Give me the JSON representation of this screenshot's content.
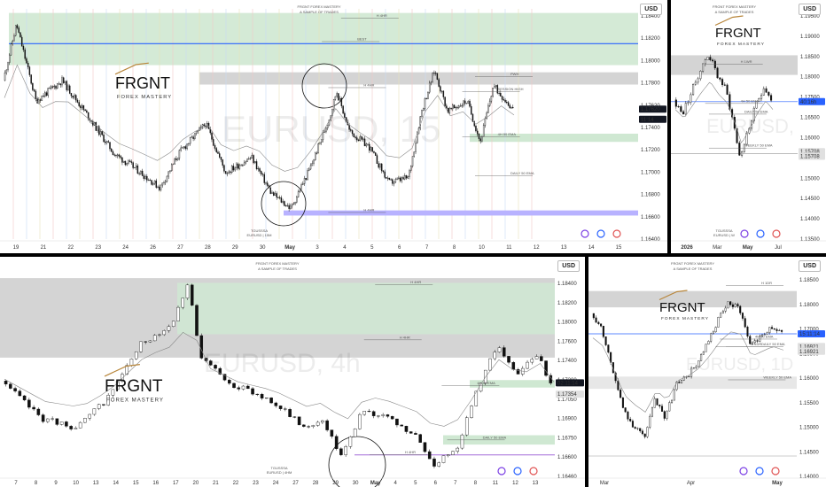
{
  "currency": "USD",
  "brand": {
    "name": "FRGNT",
    "tagline": "FOREX MASTERY"
  },
  "colors": {
    "up": "#111111",
    "down": "#111111",
    "zone_green": "#cfe8d2",
    "zone_gray": "#d4d4d4",
    "blue": "#2962ff",
    "purple": "#a46bd8",
    "dark_tag": "#131722"
  },
  "chart_data": [
    {
      "id": "p1",
      "type": "candlestick",
      "symbol": "EURUSD",
      "timeframe": "15m",
      "watermark": "EURUSD, 15",
      "header_title": "FRGNT FOREX MASTERY",
      "header_sub": "A SAMPLE OF TRADES",
      "source_line1": "TGUSSSA",
      "source_line2": "EURUSD | 15M",
      "yticks": [
        "1.18400",
        "1.18200",
        "1.18000",
        "1.17800",
        "1.17620",
        "1.17400",
        "1.17200",
        "1.17000",
        "1.16800",
        "1.16600",
        "1.16400"
      ],
      "ylim": [
        1.1635,
        1.186
      ],
      "xticks": [
        "19",
        "21",
        "22",
        "23",
        "24",
        "26",
        "27",
        "28",
        "29",
        "30",
        "May",
        "3",
        "4",
        "5",
        "6",
        "7",
        "8",
        "10",
        "11",
        "12",
        "13",
        "14",
        "15"
      ],
      "price_tags": [
        {
          "text": "1.17620",
          "y": 1.1762,
          "style": "dark"
        },
        {
          "text": "11:14",
          "y": 1.1752,
          "style": "dark"
        }
      ],
      "annotations": [
        {
          "text": "SESSION HIGH",
          "x": 0.78,
          "y": 1.1779
        },
        {
          "text": "PWH",
          "x": 0.8,
          "y": 1.1794
        },
        {
          "text": "4H 50 EMA",
          "x": 0.78,
          "y": 1.1735
        },
        {
          "text": "DAILY 50 EMA",
          "x": 0.8,
          "y": 1.1697
        },
        {
          "text": "H 4HR",
          "x": 0.57,
          "y": 1.1783
        },
        {
          "text": "BEST",
          "x": 0.56,
          "y": 1.1828
        },
        {
          "text": "H 4HR",
          "x": 0.57,
          "y": 1.1661
        },
        {
          "text": "H 4HR",
          "x": 0.59,
          "y": 1.1851
        }
      ],
      "ticker_text": "TYLONNYC",
      "seed": 11,
      "start": 1.179,
      "end": 1.1762,
      "n": 330,
      "path": [
        [
          0,
          1.179
        ],
        [
          0.02,
          1.1845
        ],
        [
          0.05,
          1.177
        ],
        [
          0.09,
          1.179
        ],
        [
          0.13,
          1.1755
        ],
        [
          0.17,
          1.1718
        ],
        [
          0.2,
          1.1705
        ],
        [
          0.24,
          1.1685
        ],
        [
          0.27,
          1.172
        ],
        [
          0.31,
          1.1748
        ],
        [
          0.34,
          1.17
        ],
        [
          0.38,
          1.1715
        ],
        [
          0.41,
          1.168
        ],
        [
          0.44,
          1.1665
        ],
        [
          0.47,
          1.1705
        ],
        [
          0.5,
          1.1755
        ],
        [
          0.51,
          1.178
        ],
        [
          0.53,
          1.174
        ],
        [
          0.56,
          1.1725
        ],
        [
          0.59,
          1.169
        ],
        [
          0.62,
          1.1695
        ],
        [
          0.64,
          1.176
        ],
        [
          0.66,
          1.18
        ],
        [
          0.68,
          1.176
        ],
        [
          0.71,
          1.177
        ],
        [
          0.73,
          1.173
        ],
        [
          0.75,
          1.1785
        ],
        [
          0.78,
          1.1762
        ]
      ]
    },
    {
      "id": "p2",
      "type": "candlestick",
      "symbol": "EURUSD",
      "timeframe": "W",
      "watermark": "EURUSD, W",
      "header_title": "FRGNT FOREX MASTERY",
      "header_sub": "A SAMPLE OF TRADES",
      "source_line1": "TGUSSSA",
      "source_line2": "EURUSD | W",
      "yticks": [
        "1.19500",
        "1.19000",
        "1.18500",
        "1.18000",
        "1.17500",
        "1.16500",
        "1.16000",
        "1.15500",
        "1.15000",
        "1.14500",
        "1.14000",
        "1.13500"
      ],
      "ylim": [
        1.133,
        1.1975
      ],
      "xticks": [
        "2026",
        "Mar",
        "May",
        "Jul"
      ],
      "price_tags": [
        {
          "text": "40:16h",
          "y": 1.1715,
          "style": "blue"
        },
        {
          "text": "1.15708",
          "y": 1.1575,
          "style": "gray"
        },
        {
          "text": "1.15708",
          "y": 1.1562,
          "style": "gray"
        }
      ],
      "annotations": [
        {
          "text": "H 1WR",
          "x": 0.55,
          "y": 1.182
        },
        {
          "text": "4H 50 EMA",
          "x": 0.55,
          "y": 1.171
        },
        {
          "text": "DAILY 50 EMA",
          "x": 0.58,
          "y": 1.168
        },
        {
          "text": "WEEKLY 50 EMA",
          "x": 0.58,
          "y": 1.1585
        }
      ],
      "seed": 23,
      "start": 1.172,
      "end": 1.172,
      "n": 40,
      "path": [
        [
          0,
          1.172
        ],
        [
          0.05,
          1.168
        ],
        [
          0.1,
          1.174
        ],
        [
          0.15,
          1.18
        ],
        [
          0.2,
          1.185
        ],
        [
          0.25,
          1.179
        ],
        [
          0.3,
          1.175
        ],
        [
          0.35,
          1.164
        ],
        [
          0.38,
          1.156
        ],
        [
          0.42,
          1.162
        ],
        [
          0.47,
          1.17
        ],
        [
          0.52,
          1.176
        ],
        [
          0.56,
          1.172
        ]
      ]
    },
    {
      "id": "p3",
      "type": "candlestick",
      "symbol": "EURUSD",
      "timeframe": "4h",
      "watermark": "EURUSD, 4h",
      "header_title": "FRGNT FOREX MASTERY",
      "header_sub": "A SAMPLE OF TRADES",
      "source_line1": "TGUSSSA",
      "source_line2": "EURUSD | 4HM",
      "yticks": [
        "1.18400",
        "1.18200",
        "1.18000",
        "1.17600",
        "1.17400",
        "1.17200",
        "1.17050",
        "1.16900",
        "1.16750",
        "1.16600",
        "1.16460"
      ],
      "ylim": [
        1.1638,
        1.1852
      ],
      "xticks": [
        "7",
        "8",
        "9",
        "10",
        "13",
        "14",
        "15",
        "16",
        "17",
        "20",
        "21",
        "22",
        "23",
        "24",
        "27",
        "28",
        "29",
        "30",
        "May",
        "4",
        "5",
        "6",
        "7",
        "8",
        "11",
        "12",
        "13"
      ],
      "price_tags": [
        {
          "text": "02:11:14",
          "y": 1.1738,
          "style": "dark"
        },
        {
          "text": "1.17354",
          "y": 1.1726,
          "style": "gray"
        }
      ],
      "annotations": [
        {
          "text": "H 4HR",
          "x": 0.72,
          "y": 1.1784
        },
        {
          "text": "4H 50 EMA",
          "x": 0.86,
          "y": 1.1735
        },
        {
          "text": "DAILY 50 EMA",
          "x": 0.87,
          "y": 1.1677
        },
        {
          "text": "H 4HR",
          "x": 0.73,
          "y": 1.1661
        },
        {
          "text": "H 4HR",
          "x": 0.74,
          "y": 1.1843
        }
      ],
      "seed": 37,
      "start": 1.176,
      "end": 1.1735,
      "n": 118,
      "path": [
        [
          0,
          1.174
        ],
        [
          0.07,
          1.17
        ],
        [
          0.13,
          1.169
        ],
        [
          0.18,
          1.172
        ],
        [
          0.24,
          1.178
        ],
        [
          0.29,
          1.18
        ],
        [
          0.32,
          1.1845
        ],
        [
          0.34,
          1.1765
        ],
        [
          0.4,
          1.1735
        ],
        [
          0.46,
          1.172
        ],
        [
          0.52,
          1.169
        ],
        [
          0.55,
          1.17
        ],
        [
          0.58,
          1.166
        ],
        [
          0.62,
          1.171
        ],
        [
          0.66,
          1.17
        ],
        [
          0.71,
          1.168
        ],
        [
          0.74,
          1.165
        ],
        [
          0.78,
          1.167
        ],
        [
          0.82,
          1.174
        ],
        [
          0.85,
          1.178
        ],
        [
          0.88,
          1.1745
        ],
        [
          0.92,
          1.177
        ],
        [
          0.94,
          1.1735
        ]
      ]
    },
    {
      "id": "p4",
      "type": "candlestick",
      "symbol": "EURUSD",
      "timeframe": "1D",
      "watermark": "EURUSD, 1D",
      "header_title": "FRGNT FOREX MASTERY",
      "header_sub": "A SAMPLE OF TRADES",
      "yticks": [
        "1.18500",
        "1.18000",
        "1.17000",
        "1.16500",
        "1.16000",
        "1.15500",
        "1.15000",
        "1.14500",
        "1.14000"
      ],
      "ylim": [
        1.1375,
        1.1875
      ],
      "xticks": [
        "Mar",
        "Apr",
        "May"
      ],
      "price_tags": [
        {
          "text": "15:11:14",
          "y": 1.1725,
          "style": "blue"
        },
        {
          "text": "1.16921",
          "y": 1.1694,
          "style": "gray"
        },
        {
          "text": "1.16921",
          "y": 1.1682,
          "style": "gray"
        }
      ],
      "annotations": [
        {
          "text": "H 1DR",
          "x": 0.83,
          "y": 1.1843
        },
        {
          "text": "4H 50 EMA",
          "x": 0.8,
          "y": 1.1712
        },
        {
          "text": "DAILY 50 EMA",
          "x": 0.83,
          "y": 1.1693
        },
        {
          "text": "WEEKLY 50 EMA",
          "x": 0.84,
          "y": 1.1612
        },
        {
          "text": "H 1DR",
          "x": 0.78,
          "y": 1.1693
        }
      ],
      "seed": 53,
      "start": 1.176,
      "end": 1.1725,
      "n": 78,
      "path": [
        [
          0,
          1.1775
        ],
        [
          0.05,
          1.174
        ],
        [
          0.1,
          1.164
        ],
        [
          0.15,
          1.154
        ],
        [
          0.2,
          1.15
        ],
        [
          0.25,
          1.147
        ],
        [
          0.3,
          1.156
        ],
        [
          0.35,
          1.152
        ],
        [
          0.4,
          1.16
        ],
        [
          0.45,
          1.162
        ],
        [
          0.5,
          1.165
        ],
        [
          0.55,
          1.17
        ],
        [
          0.6,
          1.176
        ],
        [
          0.65,
          1.18
        ],
        [
          0.7,
          1.179
        ],
        [
          0.75,
          1.17
        ],
        [
          0.8,
          1.172
        ],
        [
          0.85,
          1.174
        ],
        [
          0.9,
          1.1725
        ]
      ]
    }
  ]
}
